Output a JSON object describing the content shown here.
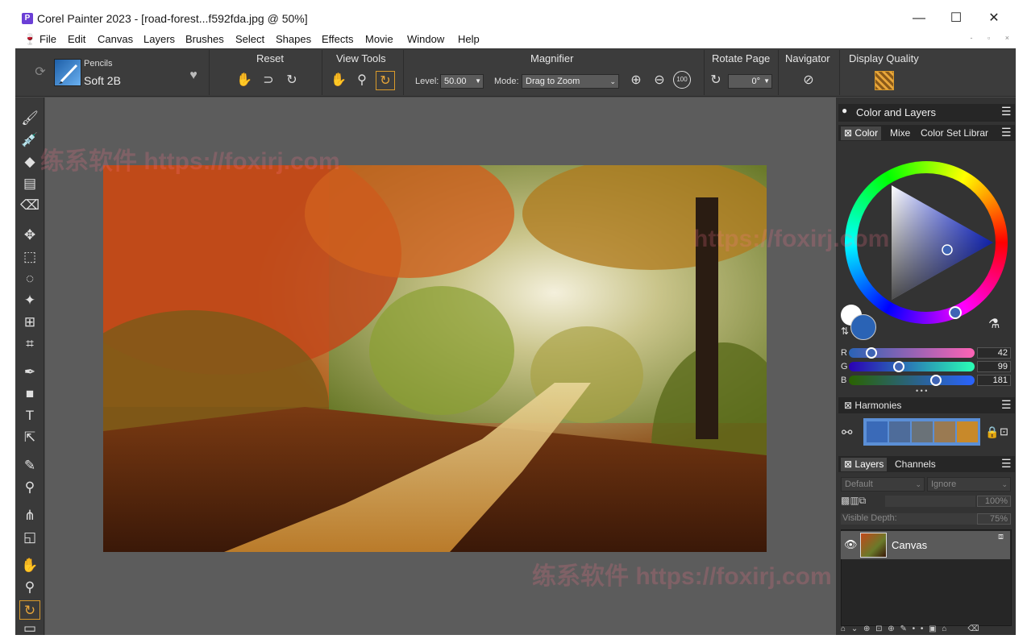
{
  "window": {
    "title": "Corel Painter 2023 - [road-forest...f592fda.jpg @ 50%]",
    "app_icon_letter": "P",
    "minimize": "—",
    "maximize": "☐",
    "close": "✕"
  },
  "menu": [
    "File",
    "Edit",
    "Canvas",
    "Layers",
    "Brushes",
    "Select",
    "Shapes",
    "Effects",
    "Movie",
    "Window",
    "Help"
  ],
  "mdi_controls": "- ▫ ×",
  "propertybar": {
    "brush_category": "Pencils",
    "brush_variant": "Soft 2B",
    "reset_label": "Reset",
    "view_tools_label": "View Tools",
    "magnifier_label": "Magnifier",
    "level_label": "Level:",
    "level_value": "50.00",
    "mode_label": "Mode:",
    "mode_value": "Drag to Zoom",
    "zoom_100": "100",
    "rotate_page_label": "Rotate Page",
    "rotate_value": "0°",
    "navigator_label": "Navigator",
    "display_quality_label": "Display Quality"
  },
  "panels": {
    "color_and_layers": "Color and Layers",
    "color_tabs": [
      "Color",
      "Mixe",
      "Color Set Librar"
    ],
    "rgb": {
      "r_label": "R",
      "r_value": "42",
      "g_label": "G",
      "g_value": "99",
      "b_label": "B",
      "b_value": "181"
    },
    "more_dots": "• • •",
    "harmonies_title": "Harmonies",
    "harmony_swatches": [
      "#3a6ab8",
      "#4e6c9a",
      "#6a7278",
      "#9a7a52",
      "#c8892a"
    ],
    "layers_tabs": [
      "Layers",
      "Channels"
    ],
    "composite_method": "Default",
    "composite_depth": "Ignore",
    "opacity_value": "100%",
    "visible_depth_label": "Visible Depth:",
    "visible_depth_value": "75%",
    "layer_name": "Canvas"
  },
  "colors": {
    "main_color": "#2a63b5",
    "accent_active": "#d99a2b"
  },
  "watermarks": [
    "练系软件 https://foxirj.com",
    "https://foxirj.com"
  ]
}
